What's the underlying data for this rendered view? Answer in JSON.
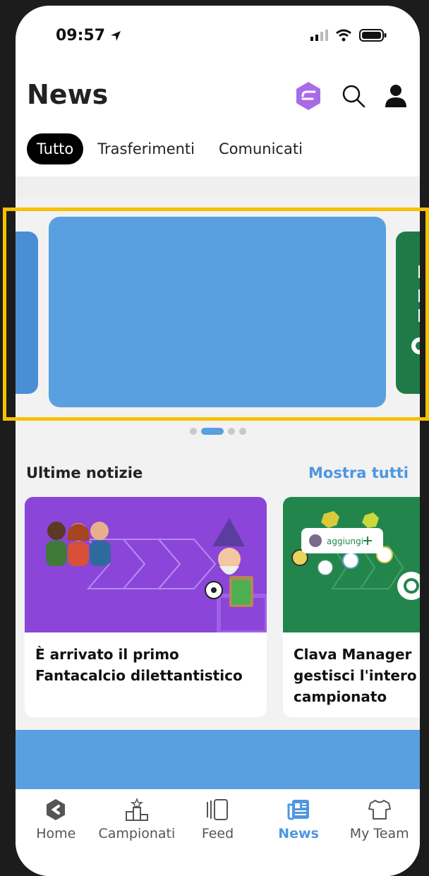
{
  "status": {
    "time": "09:57"
  },
  "header": {
    "title": "News"
  },
  "tabs": [
    {
      "label": "Tutto"
    },
    {
      "label": "Trasferimenti"
    },
    {
      "label": "Comunicati"
    }
  ],
  "carousel": {
    "active_index": 1,
    "count": 4
  },
  "latest": {
    "title": "Ultime notizie",
    "see_all": "Mostra tutti",
    "cards": [
      {
        "title": "È arrivato il primo Fantacalcio dilettantistico"
      },
      {
        "title": "Clava Manager gestisci l'intero campionato",
        "pill": "aggiungi"
      }
    ]
  },
  "tabbar": [
    {
      "label": "Home",
      "icon": "home-logo-icon"
    },
    {
      "label": "Campionati",
      "icon": "podium-icon"
    },
    {
      "label": "Feed",
      "icon": "feed-icon"
    },
    {
      "label": "News",
      "icon": "newspaper-icon",
      "active": true
    },
    {
      "label": "My Team",
      "icon": "jersey-icon"
    }
  ],
  "colors": {
    "accent": "#4e97e0",
    "highlight": "#f6c100",
    "purple": "#8b45d9",
    "green": "#22864c"
  }
}
